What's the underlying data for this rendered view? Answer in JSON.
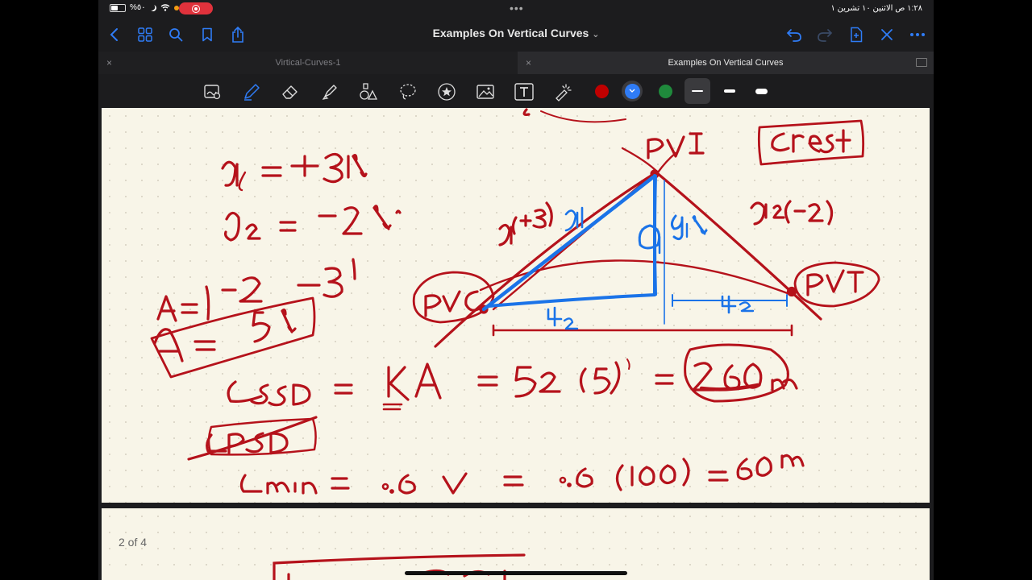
{
  "status_bar": {
    "battery": "%٥٠",
    "clock": "١:٢٨ ص   الاثنين ١٠ تشرين ١",
    "multitask": "•••"
  },
  "toolbar": {
    "title": "Examples On Vertical Curves",
    "title_chevron": "⌄"
  },
  "tabs": [
    {
      "label": "Virtical-Curves-1",
      "close": "×",
      "active": false
    },
    {
      "label": "Examples On Vertical Curves",
      "close": "×",
      "active": true
    }
  ],
  "tools": {
    "colors": [
      {
        "name": "red",
        "hex": "#c00000"
      },
      {
        "name": "blue",
        "hex": "#2f7cf6",
        "selected": true
      },
      {
        "name": "green",
        "hex": "#1f8a3c"
      }
    ],
    "stroke_widths": [
      "thin",
      "medium",
      "thick"
    ],
    "selected_stroke": "thin"
  },
  "note": {
    "ink_colors": {
      "red": "#b5121b",
      "blue": "#1a73e8"
    },
    "page_indicator": "2 of 4"
  }
}
